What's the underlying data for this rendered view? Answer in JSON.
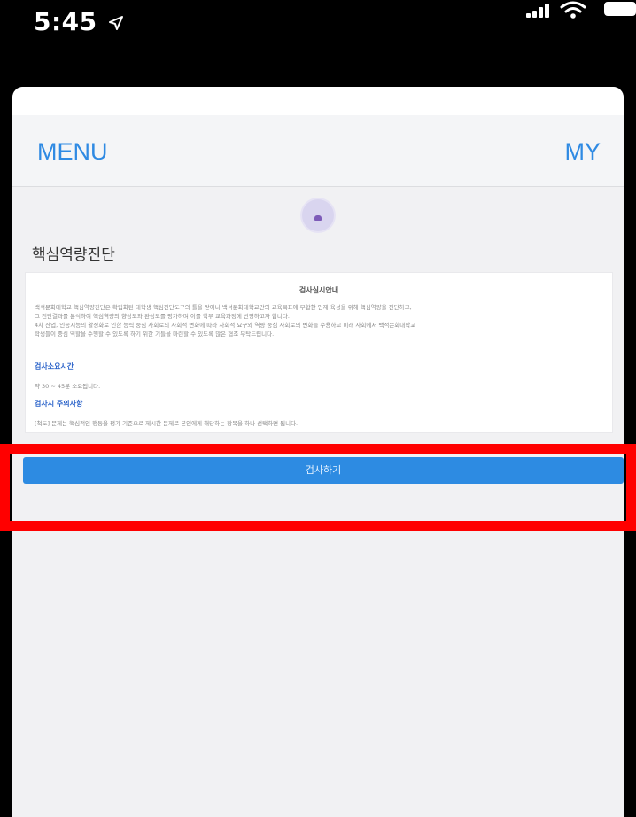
{
  "status_bar": {
    "time": "5:45",
    "location_icon": "location-arrow-icon",
    "signal_icon": "cellular-signal-icon",
    "wifi_icon": "wifi-icon",
    "battery_icon": "battery-icon"
  },
  "header": {
    "menu_label": "MENU",
    "my_label": "MY",
    "accent_color": "#2f8ae3"
  },
  "page": {
    "avatar_icon": "profile-avatar-icon",
    "title": "핵심역량진단"
  },
  "info": {
    "heading": "검사실시안내",
    "body_lines": [
      "백석문화대학교 핵심역량진단은 확립화된 대학생 핵심진단도구의 틀을 받아나 백석문화대학교만의 교육목표에 부합한 인재 육성을 위해 핵심역량을 진단하고,",
      "그 진단결과를 분석하여 핵심역량의 향상도와 완성도를 평가하며 이를 학부 교육과정에 반영하고자 합니다.",
      "4차 산업, 인공지능의 활성화로 인한 능력 중심 사회로의 사회적 변화에 따라 사회적 요구와 역량 중심 사회로의 변화를 수용하고 미래 사회에서 백석문화대학교",
      "학생들이 중심 역할을 수행할 수 있도록 하기 위한 기틀을 마련할 수 있도록 많은 협조 부탁드립니다."
    ],
    "time_heading": "검사소요시간",
    "time_text": "약 30 ~ 45분 소요됩니다.",
    "caution_heading": "검사시 주의사항",
    "caution_text": "[척도] 문제는 핵심적인 행동을 평가 기준으로 제시한 문제로 본인에게 해당하는 항목을 하나 선택하면 됩니다."
  },
  "actions": {
    "start_label": "검사하기",
    "button_color": "#2d8be2",
    "highlight_color": "#ff0000"
  }
}
